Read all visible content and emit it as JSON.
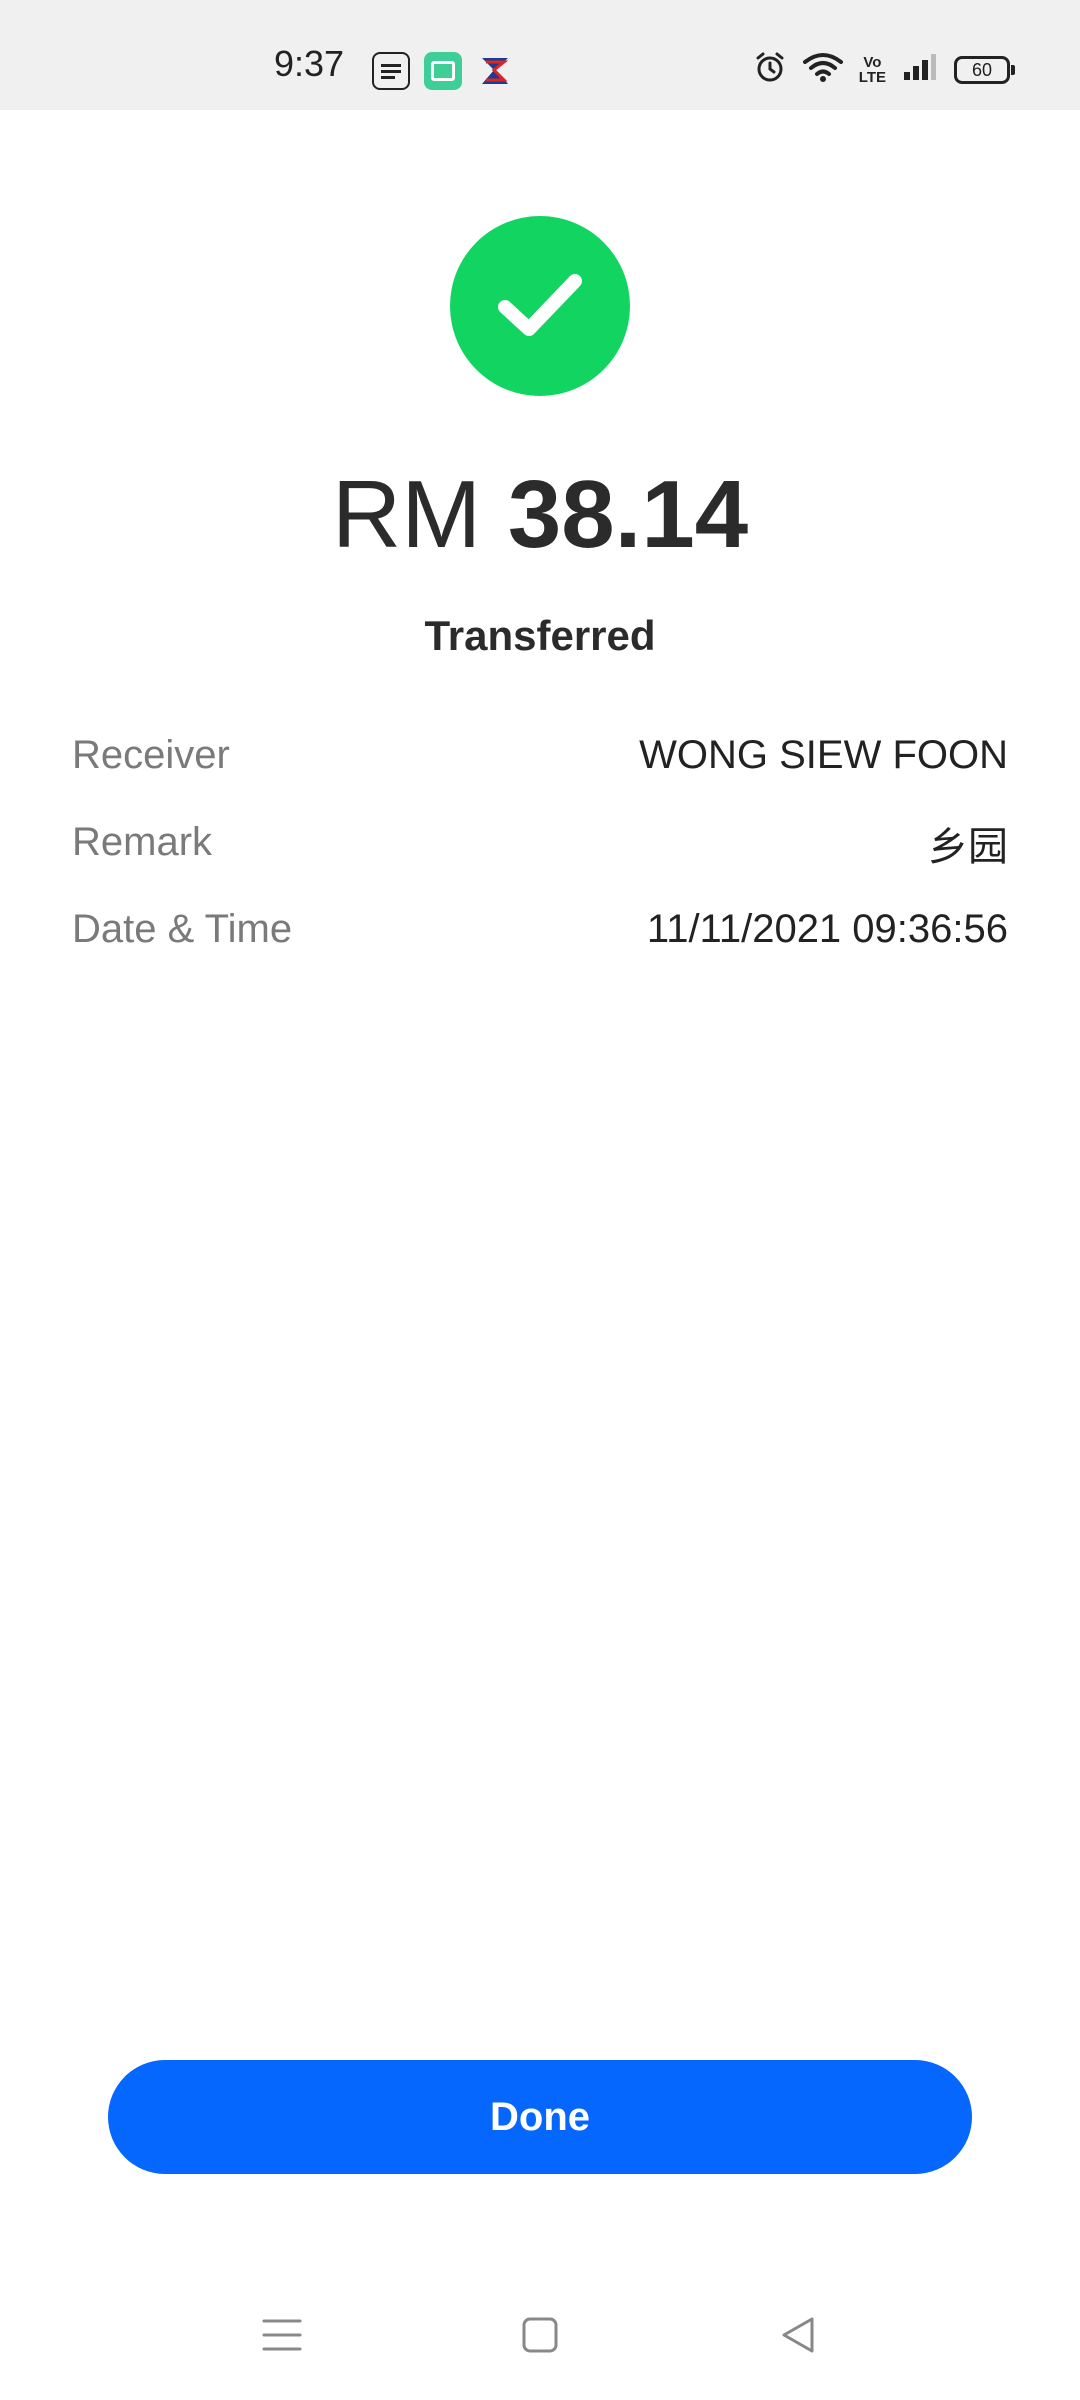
{
  "status_bar": {
    "time": "9:37",
    "notification_icons": [
      "touch-n-go-ewallet-icon",
      "green-app-icon",
      "malaysia-flag-app-icon"
    ],
    "system_icons": [
      "alarm-icon",
      "wifi-icon",
      "volte-icon",
      "signal-icon",
      "battery-icon"
    ],
    "volte_label": "Vo\nLTE",
    "battery_level": "60"
  },
  "result": {
    "icon": "checkmark-icon",
    "currency": "RM",
    "amount": "38.14",
    "status": "Transferred",
    "accent_color": "#12d460"
  },
  "details": [
    {
      "label": "Receiver",
      "value": "WONG SIEW FOON"
    },
    {
      "label": "Remark",
      "value": "乡园"
    },
    {
      "label": "Date & Time",
      "value": "11/11/2021 09:36:56"
    }
  ],
  "actions": {
    "done_label": "Done",
    "button_color": "#0567fd"
  },
  "nav_bar": {
    "items": [
      "menu-icon",
      "home-icon",
      "back-icon"
    ]
  }
}
